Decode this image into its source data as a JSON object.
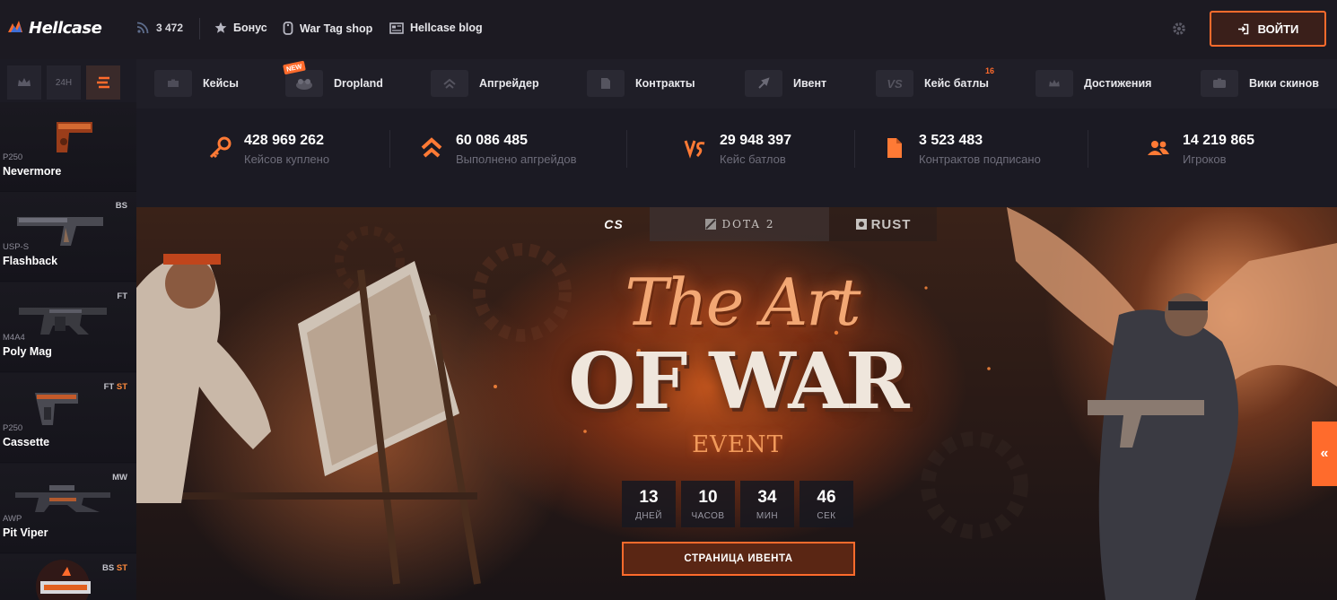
{
  "header": {
    "logo_text": "Hellcase",
    "online_count": "3 472",
    "links": [
      {
        "label": "Бонус",
        "icon": "star-icon"
      },
      {
        "label": "War Tag shop",
        "icon": "dogtag-icon"
      },
      {
        "label": "Hellcase blog",
        "icon": "newspaper-icon"
      }
    ],
    "login_label": "ВОЙТИ"
  },
  "sidebar": {
    "tabs": [
      {
        "label": "",
        "icon": "crown-icon"
      },
      {
        "label": "24H",
        "icon": ""
      },
      {
        "label": "",
        "icon": "live-drops-icon"
      }
    ],
    "drops": [
      {
        "type": "P250",
        "name": "Nevermore",
        "wear": "",
        "st": ""
      },
      {
        "type": "USP-S",
        "name": "Flashback",
        "wear": "BS",
        "st": ""
      },
      {
        "type": "M4A4",
        "name": "Poly Mag",
        "wear": "FT",
        "st": ""
      },
      {
        "type": "P250",
        "name": "Cassette",
        "wear": "FT",
        "st": "ST"
      },
      {
        "type": "AWP",
        "name": "Pit Viper",
        "wear": "MW",
        "st": ""
      },
      {
        "type": "",
        "name": "",
        "wear": "BS",
        "st": "ST"
      }
    ]
  },
  "nav": {
    "items": [
      {
        "label": "Кейсы",
        "icon": "case-icon",
        "badge": ""
      },
      {
        "label": "Dropland",
        "icon": "dropland-icon",
        "badge": "NEW"
      },
      {
        "label": "Апгрейдер",
        "icon": "upgrade-icon",
        "badge": ""
      },
      {
        "label": "Контракты",
        "icon": "contract-icon",
        "badge": ""
      },
      {
        "label": "Ивент",
        "icon": "event-icon",
        "badge": ""
      },
      {
        "label": "Кейс батлы",
        "icon": "versus-icon",
        "badge": "16"
      },
      {
        "label": "Достижения",
        "icon": "crown-icon",
        "badge": ""
      },
      {
        "label": "Вики скинов",
        "icon": "wiki-icon",
        "badge": ""
      }
    ]
  },
  "stats": [
    {
      "value": "428 969 262",
      "label": "Кейсов куплено",
      "icon": "key-icon"
    },
    {
      "value": "60 086 485",
      "label": "Выполнено апгрейдов",
      "icon": "upgrade-icon"
    },
    {
      "value": "29 948 397",
      "label": "Кейс батлов",
      "icon": "versus-icon"
    },
    {
      "value": "3 523 483",
      "label": "Контрактов подписано",
      "icon": "contract-icon"
    },
    {
      "value": "14 219 865",
      "label": "Игроков",
      "icon": "players-icon"
    }
  ],
  "banner": {
    "game_tabs": [
      "CS",
      "DOTA 2",
      "RUST"
    ],
    "title_line1": "The Art",
    "title_line2": "OF WAR",
    "title_line3": "EVENT",
    "countdown": [
      {
        "value": "13",
        "label": "ДНЕЙ"
      },
      {
        "value": "10",
        "label": "ЧАСОВ"
      },
      {
        "value": "34",
        "label": "МИН"
      },
      {
        "value": "46",
        "label": "СЕК"
      }
    ],
    "button_label": "СТРАНИЦА ИВЕНТА",
    "side_arrow": "«"
  },
  "colors": {
    "accent": "#ff6b2c",
    "bg": "#1b1b24"
  }
}
